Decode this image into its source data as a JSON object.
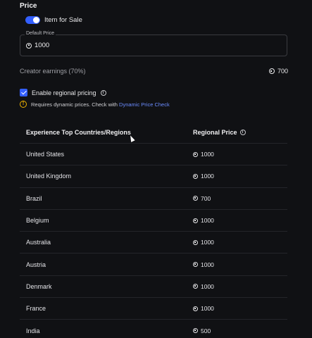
{
  "price": {
    "section_title": "Price",
    "toggle_label": "Item for Sale",
    "default_price_label": "Default Price",
    "default_price_value": "1000",
    "creator_earnings_label": "Creator earnings (70%)",
    "creator_earnings_value": "700"
  },
  "regional": {
    "checkbox_label": "Enable regional pricing",
    "warning_text": "Requires dynamic prices. Check with ",
    "warning_link": "Dynamic Price Check"
  },
  "table": {
    "headers": [
      "Experience Top Countries/Regions",
      "Regional Price"
    ],
    "rows": [
      {
        "country": "United States",
        "price": "1000"
      },
      {
        "country": "United Kingdom",
        "price": "1000"
      },
      {
        "country": "Brazil",
        "price": "700"
      },
      {
        "country": "Belgium",
        "price": "1000"
      },
      {
        "country": "Australia",
        "price": "1000"
      },
      {
        "country": "Austria",
        "price": "1000"
      },
      {
        "country": "Denmark",
        "price": "1000"
      },
      {
        "country": "France",
        "price": "1000"
      },
      {
        "country": "India",
        "price": "500"
      }
    ]
  },
  "colors": {
    "background": "#101114",
    "accent": "#335fff",
    "link": "#6b8cff",
    "warning": "#f0b400"
  },
  "icons": [
    "robux-icon",
    "info-icon",
    "warning-icon",
    "checkmark-icon"
  ]
}
